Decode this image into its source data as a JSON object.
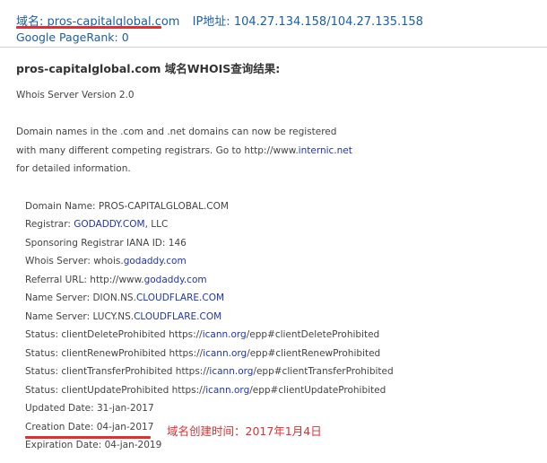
{
  "header": {
    "domain_label": "域名:",
    "domain": "pros-capitalglobal.com",
    "ip_label": "IP地址:",
    "ip": "104.27.134.158/104.27.135.158",
    "pagerank_label": "Google PageRank:",
    "pagerank": "0"
  },
  "result_title": "pros-capitalglobal.com 域名WHOIS查询结果:",
  "intro": {
    "server_version": "Whois Server Version 2.0",
    "notice_1": "Domain names in the .com and .net domains can now be registered",
    "notice_2_pre": "with many different competing registrars. Go to http://www.",
    "notice_2_link": "internic.net",
    "notice_3": "for detailed information."
  },
  "records": [
    {
      "pre": "Domain Name: PROS-CAPITALGLOBAL.COM",
      "link": "",
      "post": ""
    },
    {
      "pre": "Registrar: ",
      "link": "GODADDY.COM",
      "post": ", LLC"
    },
    {
      "pre": "Sponsoring Registrar IANA ID: 146",
      "link": "",
      "post": ""
    },
    {
      "pre": "Whois Server: whois.",
      "link": "godaddy.com",
      "post": ""
    },
    {
      "pre": "Referral URL: http://www.",
      "link": "godaddy.com",
      "post": ""
    },
    {
      "pre": "Name Server: DION.NS.",
      "link": "CLOUDFLARE.COM",
      "post": ""
    },
    {
      "pre": "Name Server: LUCY.NS.",
      "link": "CLOUDFLARE.COM",
      "post": ""
    },
    {
      "pre": "Status: clientDeleteProhibited https://",
      "link": "icann.org",
      "post": "/epp#clientDeleteProhibited"
    },
    {
      "pre": "Status: clientRenewProhibited https://",
      "link": "icann.org",
      "post": "/epp#clientRenewProhibited"
    },
    {
      "pre": "Status: clientTransferProhibited https://",
      "link": "icann.org",
      "post": "/epp#clientTransferProhibited"
    },
    {
      "pre": "Status: clientUpdateProhibited https://",
      "link": "icann.org",
      "post": "/epp#clientUpdateProhibited"
    },
    {
      "pre": "Updated Date: 31-jan-2017",
      "link": "",
      "post": ""
    },
    {
      "pre": "Creation Date: 04-jan-2017",
      "link": "",
      "post": ""
    },
    {
      "pre": "Expiration Date: 04-jan-2019",
      "link": "",
      "post": ""
    }
  ],
  "annotation": "域名创建时间：2017年1月4日",
  "colors": {
    "link": "#1f35b8",
    "header_link": "#1a5fa8",
    "highlight": "#e03030"
  }
}
